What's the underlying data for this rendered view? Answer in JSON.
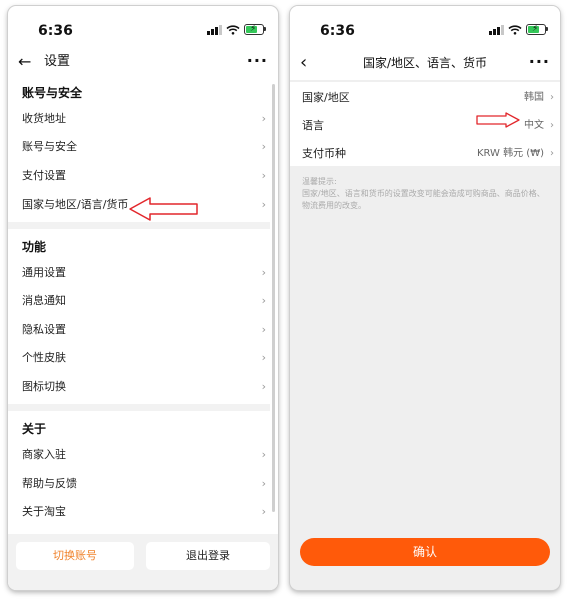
{
  "left_screen": {
    "status": {
      "time": "6:36"
    },
    "nav": {
      "title": "设置",
      "back_icon": "arrow-left-icon",
      "more_icon": "more-dots-icon"
    },
    "sections": [
      {
        "header": "账号与安全",
        "items": [
          "收货地址",
          "账号与安全",
          "支付设置",
          "国家与地区/语言/货币"
        ]
      },
      {
        "header": "功能",
        "items": [
          "通用设置",
          "消息通知",
          "隐私设置",
          "个性皮肤",
          "图标切换"
        ]
      },
      {
        "header": "关于",
        "items": [
          "商家入驻",
          "帮助与反馈",
          "关于淘宝"
        ]
      }
    ],
    "buttons": {
      "switch_account": "切换账号",
      "logout": "退出登录"
    }
  },
  "right_screen": {
    "status": {
      "time": "6:36"
    },
    "nav": {
      "title": "国家/地区、语言、货币",
      "back_icon": "chevron-left-icon",
      "more_icon": "more-dots-icon"
    },
    "rows": [
      {
        "label": "国家/地区",
        "value": "韩国"
      },
      {
        "label": "语言",
        "value": "中文"
      },
      {
        "label": "支付币种",
        "value": "KRW 韩元 (₩)"
      }
    ],
    "notice": {
      "title": "温馨提示:",
      "body": "国家/地区、语言和货币的设置改变可能会造成可购商品、商品价格、物流费用的改变。"
    },
    "confirm_button": "确认"
  },
  "colors": {
    "accent_orange": "#ff5a0a",
    "switch_account_text": "#f0832c",
    "annotation_red": "#e2262b",
    "battery_green": "#34c759"
  }
}
